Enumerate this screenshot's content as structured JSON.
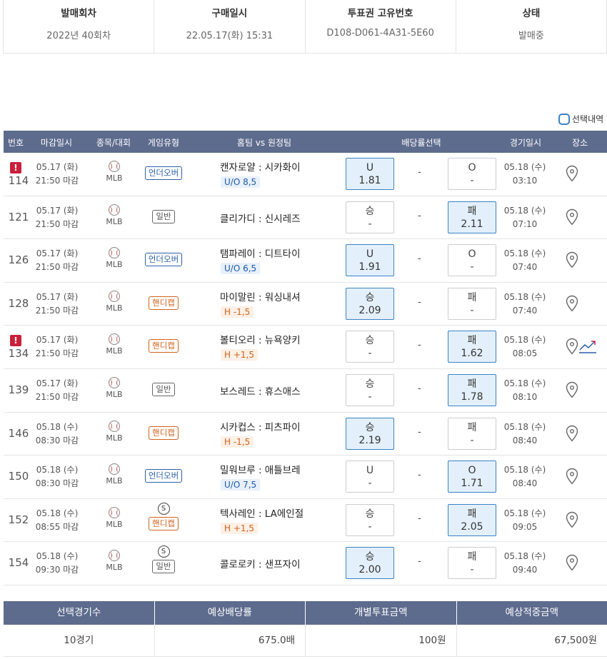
{
  "ticket": {
    "headers": [
      "발매회차",
      "구매일시",
      "투표권 고유번호",
      "상태"
    ],
    "values": [
      "2022년 40회차",
      "22.05.17(화) 15:31",
      "D108-D061-4A31-5E60",
      "발매중"
    ]
  },
  "select_toggle_label": "선택내역",
  "table_headers": [
    "번호",
    "마감일시",
    "종목/대회",
    "게임유형",
    "홈팀 vs 원정팀",
    "배당률선택",
    "경기일시",
    "장소"
  ],
  "games": [
    {
      "no": "114",
      "alert": "!",
      "deadline_date": "05.17 (화)",
      "deadline_time": "21:50 마감",
      "league": "MLB",
      "type": "언더오버",
      "type_color": "blue",
      "s_badge": "",
      "match": "캔자로얄 : 시카화이",
      "handicap": "U/O 8,5",
      "hl_color": "blue",
      "home_label": "U",
      "home_odds": "1.81",
      "home_on": true,
      "draw": "-",
      "away_label": "O",
      "away_odds": "-",
      "away_on": false,
      "game_date": "05.18 (수)",
      "game_time": "03:10",
      "trend": false
    },
    {
      "no": "121",
      "alert": "",
      "deadline_date": "05.17 (화)",
      "deadline_time": "21:50 마감",
      "league": "MLB",
      "type": "일반",
      "type_color": "gray",
      "s_badge": "",
      "match": "클리가디 : 신시레즈",
      "handicap": "",
      "hl_color": "",
      "home_label": "승",
      "home_odds": "-",
      "home_on": false,
      "draw": "-",
      "away_label": "패",
      "away_odds": "2.11",
      "away_on": true,
      "game_date": "05.18 (수)",
      "game_time": "07:10",
      "trend": false
    },
    {
      "no": "126",
      "alert": "",
      "deadline_date": "05.17 (화)",
      "deadline_time": "21:50 마감",
      "league": "MLB",
      "type": "언더오버",
      "type_color": "blue",
      "s_badge": "",
      "match": "탬파레이 : 디트타이",
      "handicap": "U/O 6,5",
      "hl_color": "blue",
      "home_label": "U",
      "home_odds": "1.91",
      "home_on": true,
      "draw": "-",
      "away_label": "O",
      "away_odds": "-",
      "away_on": false,
      "game_date": "05.18 (수)",
      "game_time": "07:40",
      "trend": false
    },
    {
      "no": "128",
      "alert": "",
      "deadline_date": "05.17 (화)",
      "deadline_time": "21:50 마감",
      "league": "MLB",
      "type": "핸디캡",
      "type_color": "orange",
      "s_badge": "",
      "match": "마이말린 : 워싱내셔",
      "handicap": "H -1,5",
      "hl_color": "orange",
      "home_label": "승",
      "home_odds": "2.09",
      "home_on": true,
      "draw": "-",
      "away_label": "패",
      "away_odds": "-",
      "away_on": false,
      "game_date": "05.18 (수)",
      "game_time": "07:40",
      "trend": false
    },
    {
      "no": "134",
      "alert": "!",
      "deadline_date": "05.17 (화)",
      "deadline_time": "21:50 마감",
      "league": "MLB",
      "type": "핸디캡",
      "type_color": "orange",
      "s_badge": "",
      "match": "볼티오리 : 뉴욕양키",
      "handicap": "H +1,5",
      "hl_color": "orange",
      "home_label": "승",
      "home_odds": "-",
      "home_on": false,
      "draw": "-",
      "away_label": "패",
      "away_odds": "1.62",
      "away_on": true,
      "game_date": "05.18 (수)",
      "game_time": "08:05",
      "trend": true
    },
    {
      "no": "139",
      "alert": "",
      "deadline_date": "05.17 (화)",
      "deadline_time": "21:50 마감",
      "league": "MLB",
      "type": "일반",
      "type_color": "gray",
      "s_badge": "",
      "match": "보스레드 : 휴스애스",
      "handicap": "",
      "hl_color": "",
      "home_label": "승",
      "home_odds": "-",
      "home_on": false,
      "draw": "-",
      "away_label": "패",
      "away_odds": "1.78",
      "away_on": true,
      "game_date": "05.18 (수)",
      "game_time": "08:10",
      "trend": false
    },
    {
      "no": "146",
      "alert": "",
      "deadline_date": "05.18 (수)",
      "deadline_time": "08:30 마감",
      "league": "MLB",
      "type": "핸디캡",
      "type_color": "orange",
      "s_badge": "",
      "match": "시카컵스 : 피츠파이",
      "handicap": "H -1,5",
      "hl_color": "orange",
      "home_label": "승",
      "home_odds": "2.19",
      "home_on": true,
      "draw": "-",
      "away_label": "패",
      "away_odds": "-",
      "away_on": false,
      "game_date": "05.18 (수)",
      "game_time": "08:40",
      "trend": false
    },
    {
      "no": "150",
      "alert": "",
      "deadline_date": "05.18 (수)",
      "deadline_time": "08:30 마감",
      "league": "MLB",
      "type": "언더오버",
      "type_color": "blue",
      "s_badge": "",
      "match": "밀워브루 : 애틀브레",
      "handicap": "U/O 7,5",
      "hl_color": "blue",
      "home_label": "U",
      "home_odds": "-",
      "home_on": false,
      "draw": "-",
      "away_label": "O",
      "away_odds": "1.71",
      "away_on": true,
      "game_date": "05.18 (수)",
      "game_time": "08:40",
      "trend": false
    },
    {
      "no": "152",
      "alert": "",
      "deadline_date": "05.18 (수)",
      "deadline_time": "08:55 마감",
      "league": "MLB",
      "type": "핸디캡",
      "type_color": "orange",
      "s_badge": "S",
      "match": "텍사레인 : LA에인절",
      "handicap": "H +1,5",
      "hl_color": "orange",
      "home_label": "승",
      "home_odds": "-",
      "home_on": false,
      "draw": "-",
      "away_label": "패",
      "away_odds": "2.05",
      "away_on": true,
      "game_date": "05.18 (수)",
      "game_time": "09:05",
      "trend": false
    },
    {
      "no": "154",
      "alert": "",
      "deadline_date": "05.18 (수)",
      "deadline_time": "09:30 마감",
      "league": "MLB",
      "type": "일반",
      "type_color": "gray",
      "s_badge": "S",
      "match": "콜로로키 : 샌프자이",
      "handicap": "",
      "hl_color": "",
      "home_label": "승",
      "home_odds": "2.00",
      "home_on": true,
      "draw": "-",
      "away_label": "패",
      "away_odds": "-",
      "away_on": false,
      "game_date": "05.18 (수)",
      "game_time": "09:40",
      "trend": false
    }
  ],
  "summary": {
    "headers": [
      "선택경기수",
      "예상배당률",
      "개별투표금액",
      "예상적중금액"
    ],
    "values": [
      "10경기",
      "675.0배",
      "100원",
      "67,500원"
    ]
  },
  "colors": {
    "header_bg": "#5d6b8d",
    "selected_bg": "#e3f0fb",
    "selected_border": "#3b82c4",
    "alert": "#c9213b"
  },
  "icons": {
    "location": "map-pin-icon",
    "trend": "trend-chart-icon",
    "sport": "baseball-icon"
  }
}
